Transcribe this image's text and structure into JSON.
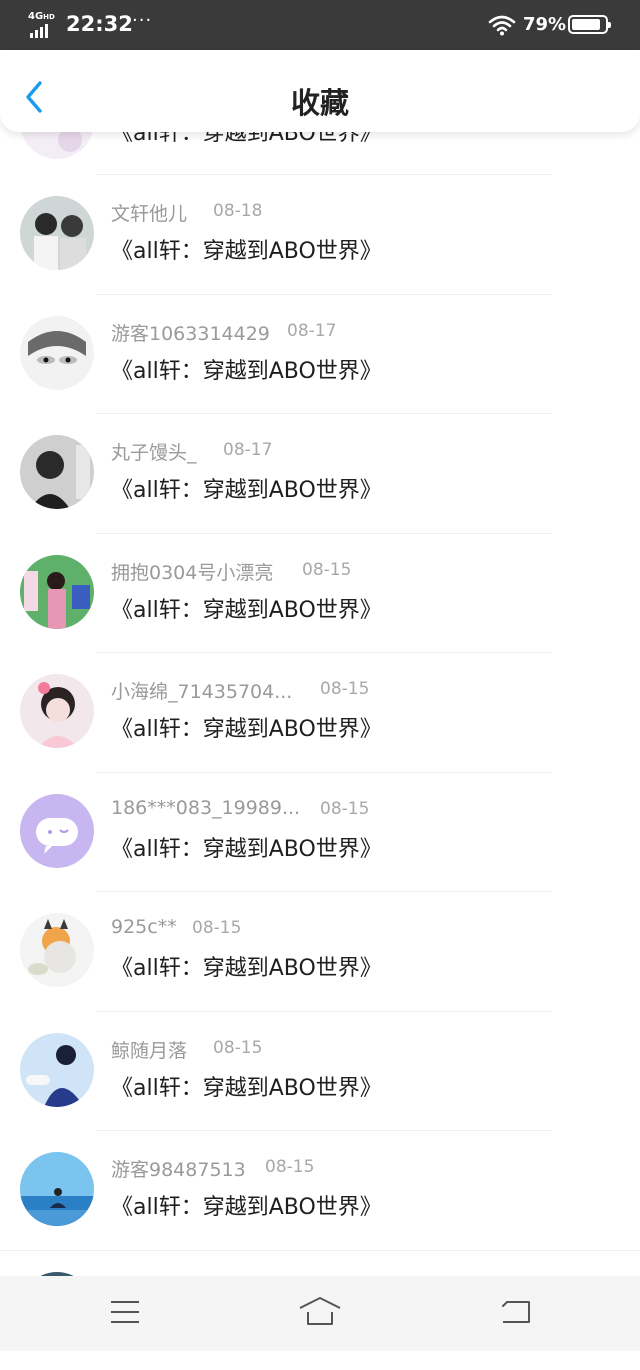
{
  "status_bar": {
    "network": "4G",
    "network_suffix": "HD",
    "time": "22:32",
    "more": "···",
    "battery_percent": "79%",
    "battery_level": 0.79
  },
  "header": {
    "title": "收藏",
    "back_icon": "chevron-left-icon",
    "accent_color": "#1a9bf0"
  },
  "list": {
    "partial_top": {
      "title": "《all轩：穿越到ABO世界》"
    },
    "items": [
      {
        "name": "文轩他儿",
        "date": "08-18",
        "title": "《all轩：穿越到ABO世界》"
      },
      {
        "name": "游客1063314429",
        "date": "08-17",
        "title": "《all轩：穿越到ABO世界》"
      },
      {
        "name": "丸子馒头_",
        "date": "08-17",
        "title": "《all轩：穿越到ABO世界》"
      },
      {
        "name": "拥抱0304号小漂亮",
        "date": "08-15",
        "title": "《all轩：穿越到ABO世界》"
      },
      {
        "name": "小海绵_71435704...",
        "date": "08-15",
        "title": "《all轩：穿越到ABO世界》"
      },
      {
        "name": "186***083_19989...",
        "date": "08-15",
        "title": "《all轩：穿越到ABO世界》"
      },
      {
        "name": "925c**",
        "date": "08-15",
        "title": "《all轩：穿越到ABO世界》"
      },
      {
        "name": "鲸随月落",
        "date": "08-15",
        "title": "《all轩：穿越到ABO世界》"
      },
      {
        "name": "游客98487513",
        "date": "08-15",
        "title": "《all轩：穿越到ABO世界》"
      }
    ]
  },
  "nav_bar": {
    "menu_icon": "menu-icon",
    "home_icon": "home-icon",
    "back_icon": "back-icon"
  }
}
